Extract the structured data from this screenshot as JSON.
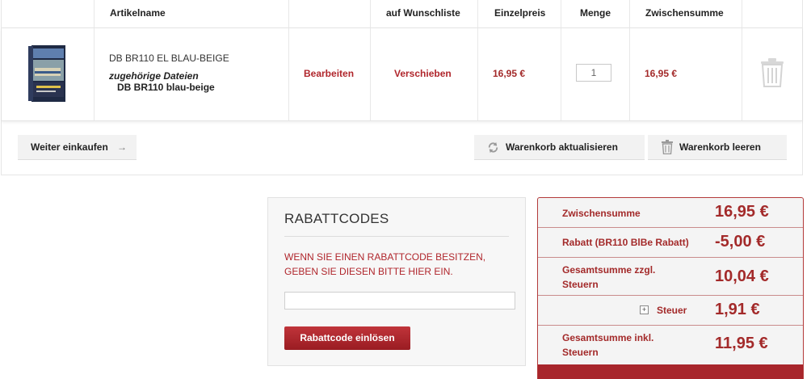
{
  "table": {
    "headers": {
      "article": "Artikelname",
      "wishlist": "auf Wunschliste",
      "unit_price": "Einzelpreis",
      "quantity": "Menge",
      "subtotal": "Zwischensumme"
    },
    "item": {
      "name": "DB BR110 EL BLAU-BEIGE",
      "files_title": "zugehörige Dateien",
      "files_item": "DB BR110 blau-beige",
      "edit": "Bearbeiten",
      "move": "Verschieben",
      "unit_price": "16,95 €",
      "quantity": "1",
      "subtotal": "16,95 €"
    }
  },
  "actions": {
    "continue": "Weiter einkaufen",
    "update": "Warenkorb aktualisieren",
    "clear": "Warenkorb leeren"
  },
  "coupon": {
    "title": "RABATTCODES",
    "description": "WENN SIE EINEN RABATTCODE BESITZEN, GEBEN SIE DIESEN BITTE HIER EIN.",
    "input_value": "",
    "button": "Rabattcode einlösen"
  },
  "totals": {
    "subtotal_label": "Zwischensumme",
    "subtotal_value": "16,95 €",
    "discount_label": "Rabatt (BR110 BlBe Rabatt)",
    "discount_value": "-5,00 €",
    "net_label": "Gesamtsumme zzgl. Steuern",
    "net_value": "10,04 €",
    "tax_label": "Steuer",
    "tax_value": "1,91 €",
    "gross_label": "Gesamtsumme inkl. Steuern",
    "gross_value": "11,95 €"
  },
  "colors": {
    "accent": "#a32a2a",
    "button": "#b0262c"
  }
}
